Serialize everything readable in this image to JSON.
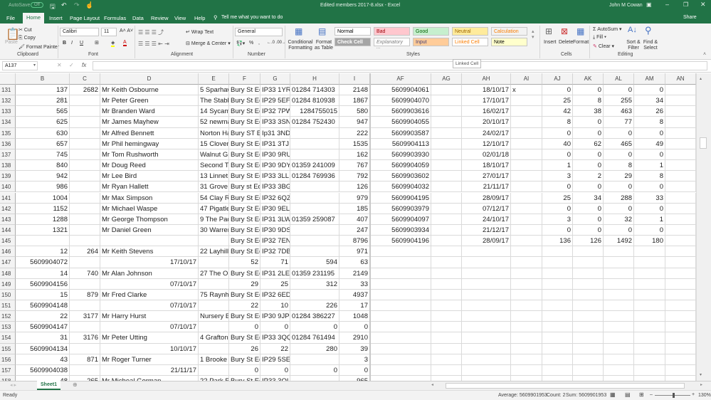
{
  "title": {
    "autosave": "AutoSave",
    "autosave_state": "Off",
    "doc": "Edited members 2017-8.xlsx  -  Excel",
    "user": "John M Cowan",
    "share": "Share"
  },
  "tabs": [
    "File",
    "Home",
    "Insert",
    "Page Layout",
    "Formulas",
    "Data",
    "Review",
    "View",
    "Help"
  ],
  "tell_me": "Tell me what you want to do",
  "ribbon": {
    "clipboard": {
      "paste": "Paste",
      "cut": "Cut",
      "copy": "Copy",
      "format_painter": "Format Painter",
      "label": "Clipboard"
    },
    "font": {
      "name": "Calibri",
      "size": "11",
      "label": "Font",
      "bold": "B",
      "italic": "I",
      "underline": "U"
    },
    "alignment": {
      "wrap": "Wrap Text",
      "merge": "Merge & Center",
      "label": "Alignment"
    },
    "number": {
      "format": "General",
      "percent": "%",
      "comma": ",",
      "label": "Number"
    },
    "styles": {
      "conditional": "Conditional Formatting",
      "format_table": "Format as Table",
      "label": "Styles",
      "cells": [
        {
          "text": "Normal",
          "bg": "#ffffff",
          "fg": "#000000"
        },
        {
          "text": "Bad",
          "bg": "#ffc7ce",
          "fg": "#9c0006"
        },
        {
          "text": "Good",
          "bg": "#c6efce",
          "fg": "#006100"
        },
        {
          "text": "Neutral",
          "bg": "#ffeb9c",
          "fg": "#9c6500"
        },
        {
          "text": "Calculation",
          "bg": "#f2f2f2",
          "fg": "#fa7d00"
        },
        {
          "text": "Check Cell",
          "bg": "#a5a5a5",
          "fg": "#ffffff"
        },
        {
          "text": "Explanatory ...",
          "bg": "#ffffff",
          "fg": "#7f7f7f"
        },
        {
          "text": "Input",
          "bg": "#ffcc99",
          "fg": "#3f3f76"
        },
        {
          "text": "Linked Cell",
          "bg": "#ffffff",
          "fg": "#fa7d00"
        },
        {
          "text": "Note",
          "bg": "#ffffcc",
          "fg": "#000000"
        }
      ]
    },
    "cells": {
      "insert": "Insert",
      "delete": "Delete",
      "format": "Format",
      "label": "Cells"
    },
    "editing": {
      "autosum": "AutoSum",
      "fill": "Fill",
      "clear": "Clear",
      "sort": "Sort & Filter",
      "find": "Find & Select",
      "label": "Editing"
    },
    "tooltip": "Linked Cell"
  },
  "formula_bar": {
    "name_box": "A137",
    "fx": "fx",
    "value": ""
  },
  "grid": {
    "left_cols": [
      "B",
      "C",
      "D",
      "E",
      "F",
      "G",
      "H",
      "I"
    ],
    "right_cols": [
      "AF",
      "AG",
      "AH",
      "AI",
      "AJ",
      "AK",
      "AL",
      "AM",
      "AN"
    ],
    "rows": [
      {
        "n": "131",
        "left": [
          "137",
          "2682",
          "Mr Keith  Osbourne",
          "5 Sparhaw",
          "Bury St Ed",
          "IP33 1YR",
          "01284 714303",
          "2148"
        ],
        "right": [
          "5609904061",
          "",
          "18/10/17",
          "x",
          "0",
          "0",
          "0",
          "0",
          ""
        ]
      },
      {
        "n": "132",
        "left": [
          "281",
          "",
          "Mr Peter  Green",
          "The Stable",
          "Bury St Ed",
          "IP29 5EF",
          "01284 810938",
          "1867"
        ],
        "right": [
          "5609904070",
          "",
          "17/10/17",
          "",
          "25",
          "8",
          "255",
          "34",
          ""
        ]
      },
      {
        "n": "133",
        "left": [
          "565",
          "",
          "Mr Branden  Ward",
          "14 Sycamc",
          "Bury St Ed",
          "IP32 7PW",
          "1284755015",
          "580"
        ],
        "right": [
          "5609903616",
          "",
          "16/02/17",
          "",
          "42",
          "38",
          "463",
          "26",
          ""
        ]
      },
      {
        "n": "134",
        "left": [
          "625",
          "",
          "Mr James  Mayhew",
          "52 newma",
          "Bury St Ed",
          "IP33 3SN",
          "01284 752430",
          "947"
        ],
        "right": [
          "5609904055",
          "",
          "20/10/17",
          "",
          "8",
          "0",
          "77",
          "8",
          ""
        ]
      },
      {
        "n": "135",
        "left": [
          "630",
          "",
          "Mr Alfred  Bennett",
          "Norton Ha",
          "Bury ST Ed",
          "Ip31 3ND",
          "",
          "222"
        ],
        "right": [
          "5609903587",
          "",
          "24/02/17",
          "",
          "0",
          "0",
          "0",
          "0",
          ""
        ]
      },
      {
        "n": "136",
        "left": [
          "657",
          "",
          "Mr Phil  hemingway",
          "15 Clovent",
          "Bury St Ed",
          "IP31 3TJ",
          "",
          "1535"
        ],
        "right": [
          "5609904113",
          "",
          "12/10/17",
          "",
          "40",
          "62",
          "465",
          "49",
          ""
        ]
      },
      {
        "n": "137",
        "left": [
          "745",
          "",
          "Mr Tom  Rushworth",
          "Walnut Gr",
          "Bury St Ed",
          "IP30 9RU",
          "",
          "162"
        ],
        "right": [
          "5609903930",
          "",
          "02/01/18",
          "",
          "0",
          "0",
          "0",
          "0",
          ""
        ]
      },
      {
        "n": "138",
        "left": [
          "840",
          "",
          "Mr Doug  Reed",
          "Second Th",
          "Bury St Ed",
          "IP30 9DY",
          "01359 241009",
          "767"
        ],
        "right": [
          "5609904059",
          "",
          "18/10/17",
          "",
          "1",
          "0",
          "8",
          "1",
          ""
        ]
      },
      {
        "n": "139",
        "left": [
          "942",
          "",
          "Mr Lee  Bird",
          "13 Linnet I",
          "Bury St Ed",
          "IP33 3LL",
          "01284 769936",
          "792"
        ],
        "right": [
          "5609903602",
          "",
          "27/01/17",
          "",
          "3",
          "2",
          "29",
          "8",
          ""
        ]
      },
      {
        "n": "140",
        "left": [
          "986",
          "",
          "Mr Ryan  Hallett",
          "31 Grove I",
          "Bury st Ed",
          "IP33 3BG",
          "",
          "126"
        ],
        "right": [
          "5609904032",
          "",
          "21/11/17",
          "",
          "0",
          "0",
          "0",
          "0",
          ""
        ]
      },
      {
        "n": "141",
        "left": [
          "1004",
          "",
          "Mr Max  Simpson",
          "54 Clay Ro",
          "Bury St Ed",
          "IP32 6QZ",
          "",
          "979"
        ],
        "right": [
          "5609904195",
          "",
          "28/09/17",
          "",
          "25",
          "34",
          "288",
          "33",
          ""
        ]
      },
      {
        "n": "142",
        "left": [
          "1152",
          "",
          "Mr Michael  Waspe",
          "47 Pigatle",
          "Bury St Ed",
          "IP30 9EL",
          "",
          "185"
        ],
        "right": [
          "5609903979",
          "",
          "07/12/17",
          "",
          "0",
          "0",
          "0",
          "0",
          ""
        ]
      },
      {
        "n": "143",
        "left": [
          "1288",
          "",
          "Mr George  Thompson",
          "9 The Padc",
          "Bury St Ed",
          "IP31 3LW",
          "01359 259087",
          "407"
        ],
        "right": [
          "5609904097",
          "",
          "24/10/17",
          "",
          "3",
          "0",
          "32",
          "1",
          ""
        ]
      },
      {
        "n": "144",
        "left": [
          "1321",
          "",
          "Mr Daniel  Green",
          "30 Warrer",
          "Bury St Ed",
          "IP30 9DS",
          "",
          "247"
        ],
        "right": [
          "5609903934",
          "",
          "21/12/17",
          "",
          "0",
          "0",
          "0",
          "0",
          ""
        ]
      },
      {
        "n": "145",
        "left": [
          "",
          "",
          "",
          "",
          "Bury St Ed",
          "IP32 7EN",
          "",
          "8796"
        ],
        "right": [
          "5609904196",
          "",
          "28/09/17",
          "",
          "136",
          "126",
          "1492",
          "180",
          ""
        ]
      },
      {
        "n": "146",
        "left": [
          "12",
          "264",
          "Mr Keith  Stevens",
          "22 Layhill (",
          "Bury St Ed",
          "IP32 7DB",
          "",
          "971"
        ],
        "right": [
          "",
          "",
          "",
          "",
          "",
          "",
          "",
          "",
          ""
        ]
      },
      {
        "n": "147",
        "left": [
          "5609904072",
          "",
          "17/10/17",
          "",
          "52",
          "71",
          "594",
          "63"
        ],
        "right": [
          "",
          "",
          "",
          "",
          "",
          "",
          "",
          "",
          ""
        ]
      },
      {
        "n": "148",
        "left": [
          "14",
          "740",
          "Mr Alan  Johnson",
          "27 The Or",
          "Bury St Ed",
          "IP31 2LE",
          "01359 231195",
          "2149"
        ],
        "right": [
          "",
          "",
          "",
          "",
          "",
          "",
          "",
          "",
          ""
        ]
      },
      {
        "n": "149",
        "left": [
          "5609904156",
          "",
          "07/10/17",
          "",
          "29",
          "25",
          "312",
          "33"
        ],
        "right": [
          "",
          "",
          "",
          "",
          "",
          "",
          "",
          "",
          ""
        ]
      },
      {
        "n": "150",
        "left": [
          "15",
          "879",
          "Mr Fred  Clarke",
          "75 Raynha",
          "Bury St Ed",
          "IP32 6ED",
          "",
          "4937"
        ],
        "right": [
          "",
          "",
          "",
          "",
          "",
          "",
          "",
          "",
          ""
        ]
      },
      {
        "n": "151",
        "left": [
          "5609904148",
          "",
          "07/10/17",
          "",
          "22",
          "10",
          "226",
          "17"
        ],
        "right": [
          "",
          "",
          "",
          "",
          "",
          "",
          "",
          "",
          ""
        ]
      },
      {
        "n": "152",
        "left": [
          "22",
          "3177",
          "Mr Harry  Hurst",
          "Nursery B",
          "Bury St Ed",
          "IP30 9JP",
          "01284 386227",
          "1048"
        ],
        "right": [
          "",
          "",
          "",
          "",
          "",
          "",
          "",
          "",
          ""
        ]
      },
      {
        "n": "153",
        "left": [
          "5609904147",
          "",
          "07/10/17",
          "",
          "0",
          "0",
          "0",
          "0"
        ],
        "right": [
          "",
          "",
          "",
          "",
          "",
          "",
          "",
          "",
          ""
        ]
      },
      {
        "n": "154",
        "left": [
          "31",
          "3176",
          "Mr Peter  Utting",
          "4 Grafton",
          "Bury St Ed",
          "IP33 3QQ",
          "01284 761494",
          "2910"
        ],
        "right": [
          "",
          "",
          "",
          "",
          "",
          "",
          "",
          "",
          ""
        ]
      },
      {
        "n": "155",
        "left": [
          "5609904134",
          "",
          "10/10/17",
          "",
          "26",
          "22",
          "280",
          "39"
        ],
        "right": [
          "",
          "",
          "",
          "",
          "",
          "",
          "",
          "",
          ""
        ]
      },
      {
        "n": "156",
        "left": [
          "43",
          "871",
          "Mr Roger  Turner",
          "1 Brooke c",
          "Bury St Ed",
          "IP29 5SE",
          "",
          "3"
        ],
        "right": [
          "",
          "",
          "",
          "",
          "",
          "",
          "",
          "",
          ""
        ]
      },
      {
        "n": "157",
        "left": [
          "5609904038",
          "",
          "21/11/17",
          "",
          "0",
          "0",
          "0",
          "0"
        ],
        "right": [
          "",
          "",
          "",
          "",
          "",
          "",
          "",
          "",
          ""
        ]
      },
      {
        "n": "158",
        "left": [
          "48",
          "265",
          "Mr Micheal  Gorman",
          "22 Park Rc",
          "Bury St Ed",
          "IP33 3QL",
          "",
          "965"
        ],
        "right": [
          "",
          "",
          "",
          "",
          "",
          "",
          "",
          "",
          ""
        ]
      }
    ]
  },
  "sheets": [
    "Sheet1"
  ],
  "status": {
    "ready": "Ready",
    "average": "Average: 5609901953",
    "count": "Count: 2",
    "sum": "Sum: 5609901953",
    "zoom": "130%"
  }
}
